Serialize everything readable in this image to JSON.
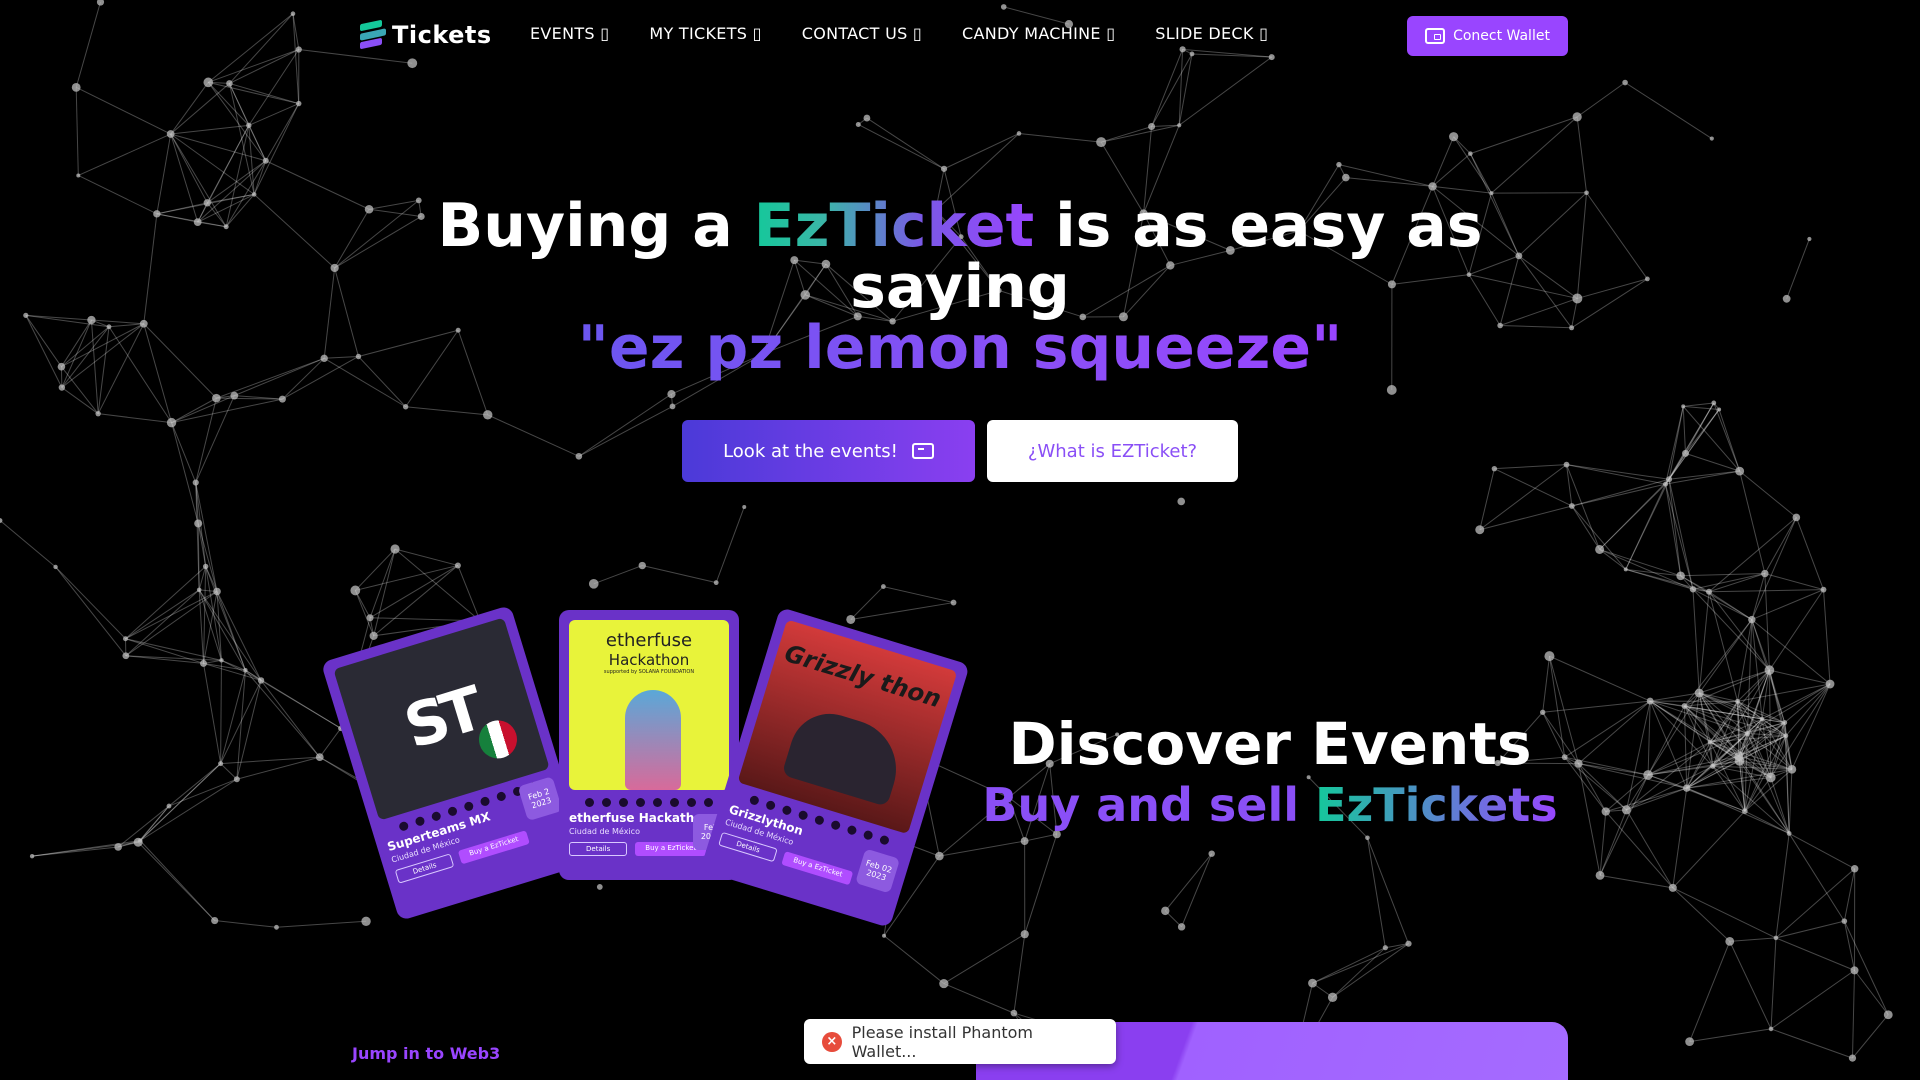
{
  "nav": {
    "logo_text": "Tickets",
    "links": [
      {
        "label": "EVENTS ▯"
      },
      {
        "label": "MY TICKETS ▯"
      },
      {
        "label": "CONTACT US ▯"
      },
      {
        "label": "CANDY MACHINE ▯"
      },
      {
        "label": "SLIDE DECK ▯"
      }
    ],
    "wallet_button": "Conect Wallet"
  },
  "hero": {
    "line1_prefix": "Buying a ",
    "line1_brand": "EzTicket",
    "line1_suffix": " is as easy as",
    "line2": "saying",
    "line3": "\"ez pz lemon squeeze\"",
    "primary_button": "Look at the events!",
    "secondary_button": "¿What is EZTicket?"
  },
  "discover": {
    "title": "Discover Events",
    "subtitle_prefix": "Buy and sell ",
    "subtitle_highlight": "EzTickets"
  },
  "cards": [
    {
      "name": "Superteams MX",
      "location": "Ciudad de México",
      "date": "Feb 2 2023",
      "details": "Details",
      "buy": "Buy a EzTicket",
      "art_text": "ST"
    },
    {
      "name": "etherfuse Hackathon",
      "location": "Ciudad de México",
      "date": "Feb 2023",
      "details": "Details",
      "buy": "Buy a EzTicket",
      "art_title": "etherfuse",
      "art_subtitle": "Hackathon",
      "art_supported": "supported by SOLANA FOUNDATION"
    },
    {
      "name": "Grizzlython",
      "location": "Ciudad de México",
      "date": "Feb 02 2023",
      "details": "Details",
      "buy": "Buy a EzTicket",
      "art_text": "Grizzly thon"
    }
  ],
  "footer": {
    "jump_text": "Jump in to Web3"
  },
  "toast": {
    "message": "Please install Phantom Wallet..."
  },
  "colors": {
    "accent": "#9945ff",
    "green": "#14c89a",
    "background": "#000000"
  }
}
